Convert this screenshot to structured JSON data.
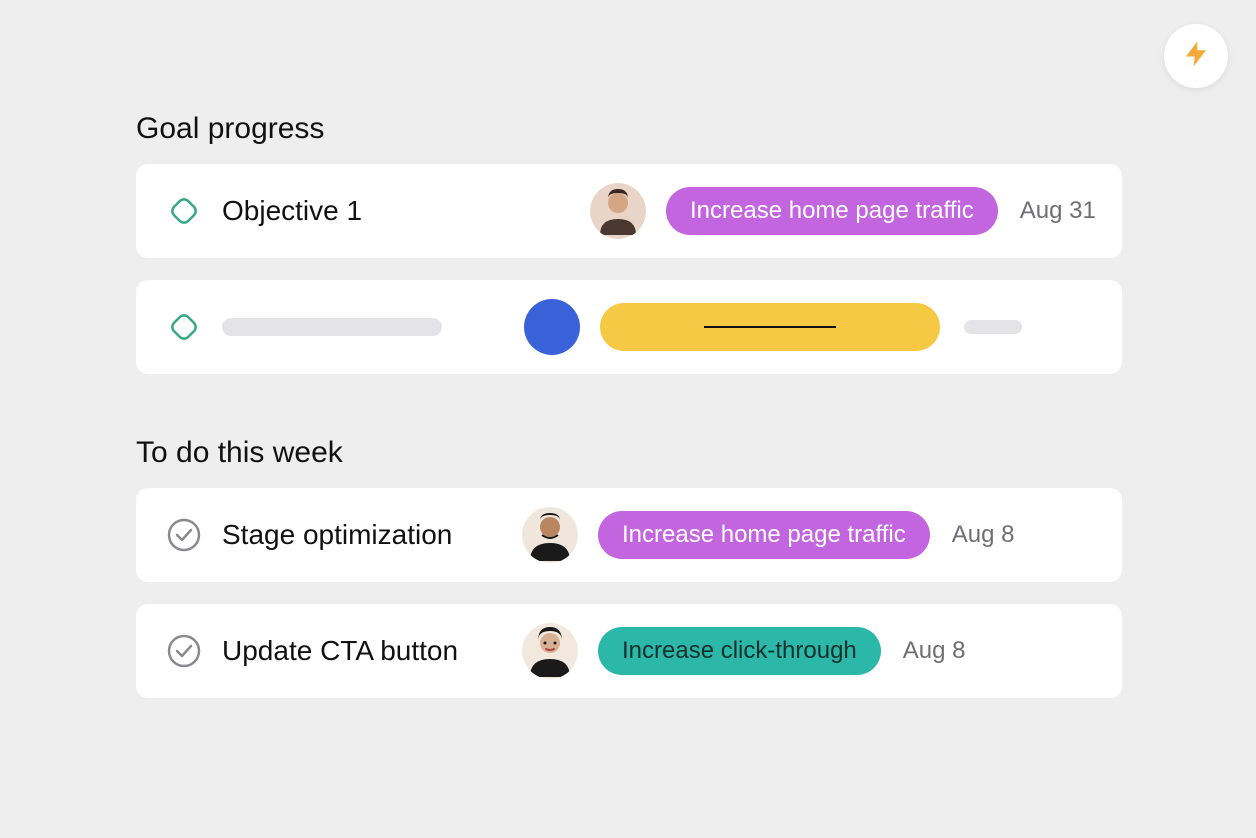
{
  "fab": {
    "icon": "lightning-icon",
    "icon_color": "#f4a836"
  },
  "sections": {
    "goal_progress": {
      "title": "Goal progress",
      "items": [
        {
          "icon": "goal-diamond-icon",
          "title": "Objective 1",
          "avatar": "avatar-1",
          "tag": {
            "label": "Increase home page traffic",
            "color": "purple"
          },
          "date": "Aug 31"
        }
      ],
      "placeholder_row": {
        "icon": "goal-diamond-icon",
        "avatar_color": "#3a62d8",
        "tag_color": "#f6c944"
      }
    },
    "todo": {
      "title": "To do this week",
      "items": [
        {
          "icon": "check-circle-icon",
          "title": "Stage optimization",
          "avatar": "avatar-2",
          "tag": {
            "label": "Increase home page traffic",
            "color": "purple"
          },
          "date": "Aug 8"
        },
        {
          "icon": "check-circle-icon",
          "title": "Update CTA button",
          "avatar": "avatar-3",
          "tag": {
            "label": "Increase click-through",
            "color": "teal"
          },
          "date": "Aug 8"
        }
      ]
    }
  },
  "colors": {
    "purple": "#c265df",
    "teal": "#2cb8a8",
    "yellow": "#f6c944",
    "blue": "#3a62d8",
    "goal_outline": "#3aa884"
  }
}
